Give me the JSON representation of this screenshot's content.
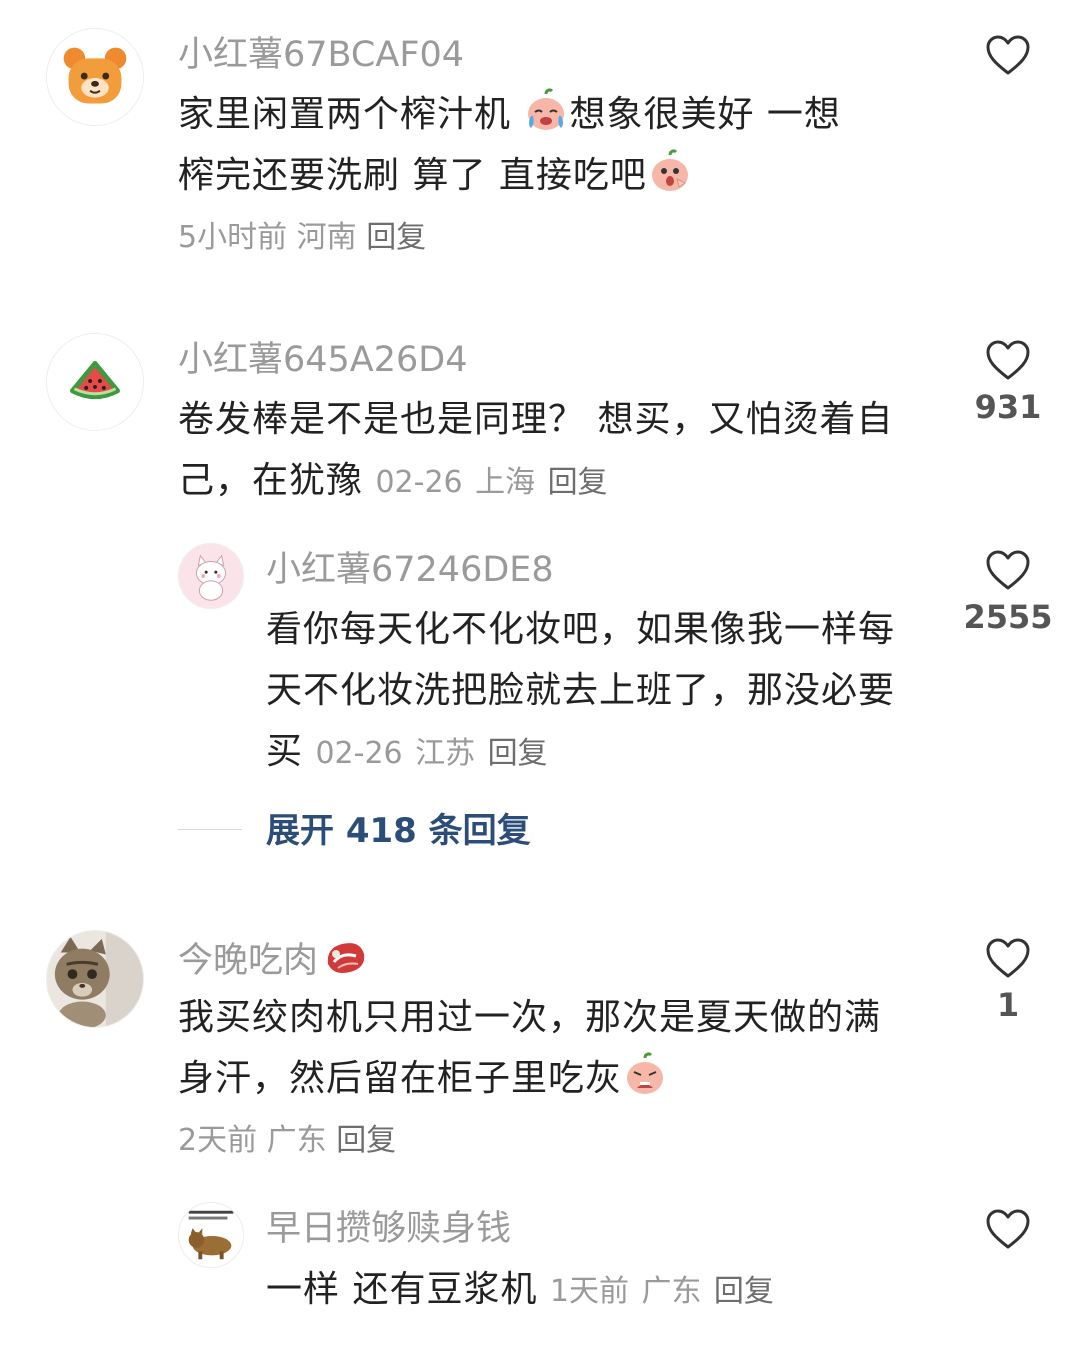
{
  "comments": [
    {
      "username": "小红薯67BCAF04",
      "avatar_icon": "bear-icon",
      "text_line1": "家里闲置两个榨汁机 ",
      "text_line1_b": "想象很美好  一想",
      "text_line2": "榨完还要洗刷 算了 直接吃吧",
      "time": "5小时前",
      "location": "河南",
      "reply": "回复",
      "likes": ""
    },
    {
      "username": "小红薯645A26D4",
      "avatar_icon": "watermelon-icon",
      "text_line1": "卷发棒是不是也是同理？ 想买，又怕烫着自",
      "text_line2": "己，在犹豫",
      "time": "02-26",
      "location": "上海",
      "reply": "回复",
      "likes": "931",
      "reply_item": {
        "username": "小红薯67246DE8",
        "avatar_icon": "white-cat-icon",
        "text_line1": "看你每天化不化妆吧，如果像我一样每",
        "text_line2": "天不化妆洗把脸就去上班了，那没必要",
        "text_line3": "买",
        "time": "02-26",
        "location": "江苏",
        "reply": "回复",
        "likes": "2555"
      },
      "expand_label": "展开 418 条回复"
    },
    {
      "username": "今晚吃肉",
      "avatar_icon": "cat-photo-icon",
      "text_line1": "我买绞肉机只用过一次，那次是夏天做的满",
      "text_line2": "身汗，然后留在柜子里吃灰",
      "time": "2天前",
      "location": "广东",
      "reply": "回复",
      "likes": "1",
      "reply_item": {
        "username": "早日攒够赎身钱",
        "avatar_icon": "cat-meme-icon",
        "text_line1": "一样 还有豆浆机",
        "time": "1天前",
        "location": "广东",
        "reply": "回复",
        "likes": ""
      }
    }
  ],
  "colors": {
    "username": "#9a9a9a",
    "text": "#222222",
    "expand": "#2b4d78"
  }
}
